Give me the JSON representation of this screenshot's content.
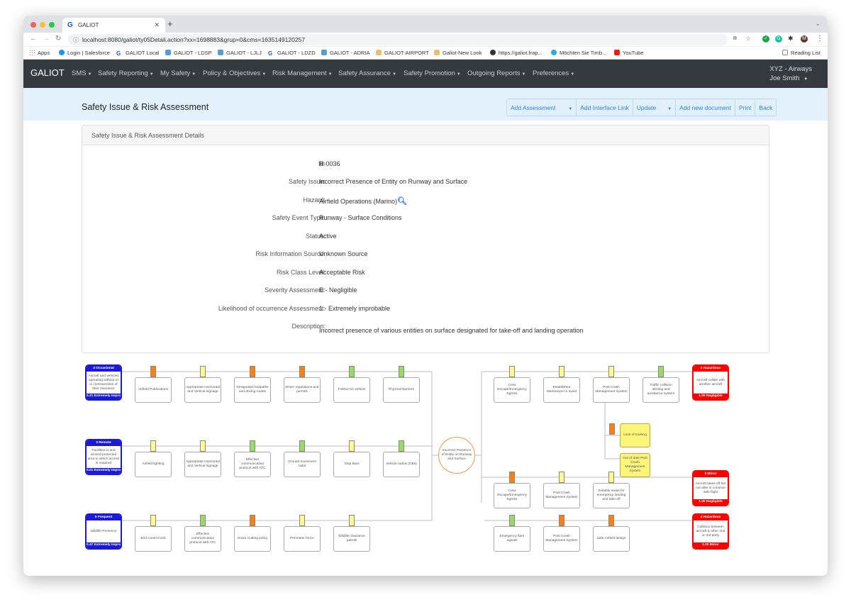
{
  "browser": {
    "tab_title": "GALIOT",
    "url": "localhost:8080/galiot/ty05Detail.action?xx=1698883&grup=0&cms=1635149120257",
    "profile_initial": "M",
    "bookmarks": [
      "Apps",
      "Login | Salesforce",
      "GALIOT Local",
      "GALIOT - LDSP",
      "GALIOT - LJLJ",
      "GALIOT - LDZD",
      "GALIOT - ADRIA",
      "GALIOT-AIRPORT",
      "Galiot-New Look",
      "https://galiot.frap...",
      "Möchten Sie Timb...",
      "YouTube"
    ],
    "reading_list": "Reading List"
  },
  "navbar": {
    "brand": "GALIOT",
    "menus": [
      "SMS",
      "Safety Reporting",
      "My Safety",
      "Policy & Objectives",
      "Risk Management",
      "Safety Assurance",
      "Safety Promotion",
      "Outgoing Reports",
      "Preferences"
    ],
    "org": "XYZ - Airways",
    "user": "Joe Smith"
  },
  "page": {
    "title": "Safety Issue & Risk Assessment",
    "buttons": [
      "Add Assessment",
      "Add Interface Link",
      "Update",
      "Add new document",
      "Print",
      "Back"
    ],
    "card_title": "Safety Issue & Risk Assessment Details",
    "fields": [
      {
        "label": "Id:",
        "value": "R-0036"
      },
      {
        "label": "Safety Issue:",
        "value": "Incorrect Presence of Entity on Runway and Surface"
      },
      {
        "label": "Hazard:",
        "value": "Airfield Operations (Marino)"
      },
      {
        "label": "Safety Event Type:",
        "value": "Runway - Surface Conditions"
      },
      {
        "label": "Status:",
        "value": "Active"
      },
      {
        "label": "Risk Information Source:",
        "value": "Unknown Source"
      },
      {
        "label": "Risk Class Level:",
        "value": "Acceptable Risk"
      },
      {
        "label": "Severity Assessment:",
        "value": "E - Negligible"
      },
      {
        "label": "Likelihood of occurrence Assessment:",
        "value": "1 - Extremely improbable"
      },
      {
        "label": "Description:",
        "value": "Incorrect presence of various entities on surface designated for take-off and landing operation"
      }
    ]
  },
  "colors": {
    "orange": "#ff7f0e",
    "yellow": "#fdfb8f",
    "green": "#99d966",
    "threat": "#1a1ad6",
    "consequence": "#ff0000",
    "center": "#f5914a"
  },
  "bowtie": {
    "top_event": "Incorrect Presence of Entity on Runway and Surface",
    "threats": [
      {
        "top": "4 Occasional",
        "text": "Aircraft and vehicles operating without or in contravention of their clearance",
        "bottom": "0.21 Extremely Improbable",
        "barriers": [
          {
            "text": "Airfield Publications",
            "c": "orange"
          },
          {
            "text": "Appropriate Horizontal and Vertical signage",
            "c": "yellow"
          },
          {
            "text": "Designated footpaths and driving routes",
            "c": "orange"
          },
          {
            "text": "Driver regulations and permits",
            "c": "orange"
          },
          {
            "text": "Follow-me vehicle",
            "c": "green"
          },
          {
            "text": "Physical Barriers",
            "c": "green"
          }
        ]
      },
      {
        "top": "3 Remote",
        "text": "Facilities in and around protected area to which access is required",
        "bottom": "0.01 Extremely Improbable",
        "barriers": [
          {
            "text": "Airfield lighting",
            "c": "yellow"
          },
          {
            "text": "Appropriate Horizontal and Vertical signage",
            "c": "yellow"
          },
          {
            "text": "Effective communication protocol with ATC",
            "c": "green"
          },
          {
            "text": "Ground movement radar",
            "c": "green"
          },
          {
            "text": "Stop Bars",
            "c": "yellow"
          },
          {
            "text": "Vehicle radios (CBs)",
            "c": "green"
          }
        ]
      },
      {
        "top": "5 Frequent",
        "text": "Wildlife Presence",
        "bottom": "0.47 Extremely Improbable",
        "barriers": [
          {
            "text": "Bird Control Unit",
            "c": "yellow"
          },
          {
            "text": "Effective communication protocol with ATC",
            "c": "green"
          },
          {
            "text": "Grass Cutting policy",
            "c": "orange"
          },
          {
            "text": "Perimeter fence",
            "c": "yellow"
          },
          {
            "text": "Wildlife clearance patrols",
            "c": "yellow"
          }
        ]
      }
    ],
    "consequences": [
      {
        "top": "4 Hazardous",
        "text": "Aircraft collide with another aircraft",
        "bottom": "1.00 Negligible",
        "barriers": [
          {
            "text": "Crew Escape/Emergency Egress",
            "c": "yellow"
          },
          {
            "text": "Established Manoeuvre to avoid",
            "c": "yellow"
          },
          {
            "text": "Post Crash Management System",
            "c": "yellow"
          },
          {
            "text": "Traffic collision alerting and avoidance system",
            "c": "green"
          }
        ]
      },
      {
        "top": "2 Minor",
        "text": "Aircraft takes off but not able to continue safe flight",
        "bottom": "1.00 Negligible",
        "barriers": [
          {
            "text": "Crew Escape/Emergency Egress",
            "c": "orange"
          },
          {
            "text": "Post Crash Management System",
            "c": "yellow"
          },
          {
            "text": "Suitable areas for emergency landing and take-off",
            "c": "yellow"
          }
        ]
      },
      {
        "top": "4 Hazardous",
        "text": "Collision between aircraft & other 2nd or 3rd party",
        "bottom": "1.00 Minor",
        "barriers": [
          {
            "text": "Emergency flare signals",
            "c": "green"
          },
          {
            "text": "Post Crash Management System",
            "c": "orange"
          },
          {
            "text": "Safe Airfield design",
            "c": "orange"
          }
        ]
      }
    ],
    "escalation_factors": [
      "Lack of training",
      "Out of date Post Crash Management System"
    ]
  }
}
